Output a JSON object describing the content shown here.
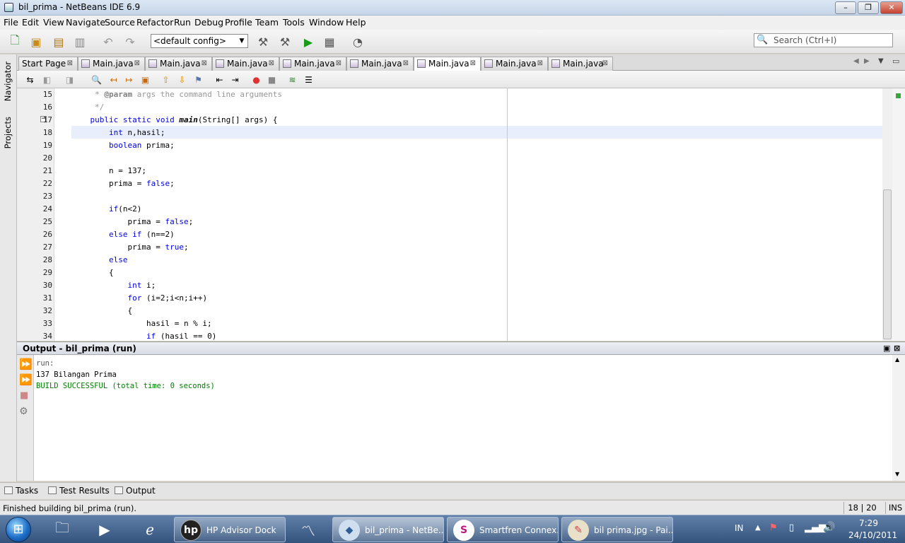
{
  "window": {
    "title": "bil_prima - NetBeans IDE 6.9"
  },
  "menu": [
    "File",
    "Edit",
    "View",
    "Navigate",
    "Source",
    "Refactor",
    "Run",
    "Debug",
    "Profile",
    "Team",
    "Tools",
    "Window",
    "Help"
  ],
  "toolbar": {
    "config": "<default config>",
    "search_placeholder": "Search (Ctrl+I)"
  },
  "side_panels": {
    "navigator": "Navigator",
    "projects": "Projects"
  },
  "tabs": [
    {
      "label": "Start Page",
      "active": false
    },
    {
      "label": "Main.java",
      "active": false
    },
    {
      "label": "Main.java",
      "active": false
    },
    {
      "label": "Main.java",
      "active": false
    },
    {
      "label": "Main.java",
      "active": false
    },
    {
      "label": "Main.java",
      "active": false
    },
    {
      "label": "Main.java",
      "active": true
    },
    {
      "label": "Main.java",
      "active": false
    },
    {
      "label": "Main.java",
      "active": false
    }
  ],
  "editor": {
    "lines": [
      {
        "no": "15",
        "text": "     * @param args the command line arguments"
      },
      {
        "no": "16",
        "text": "     */"
      },
      {
        "no": "17",
        "text": "    public static void main(String[] args) {"
      },
      {
        "no": "18",
        "text": "        int n,hasil;"
      },
      {
        "no": "19",
        "text": "        boolean prima;"
      },
      {
        "no": "20",
        "text": ""
      },
      {
        "no": "21",
        "text": "        n = 137;"
      },
      {
        "no": "22",
        "text": "        prima = false;"
      },
      {
        "no": "23",
        "text": ""
      },
      {
        "no": "24",
        "text": "        if(n<2)"
      },
      {
        "no": "25",
        "text": "            prima = false;"
      },
      {
        "no": "26",
        "text": "        else if (n==2)"
      },
      {
        "no": "27",
        "text": "            prima = true;"
      },
      {
        "no": "28",
        "text": "        else"
      },
      {
        "no": "29",
        "text": "        {"
      },
      {
        "no": "30",
        "text": "            int i;"
      },
      {
        "no": "31",
        "text": "            for (i=2;i<n;i++)"
      },
      {
        "no": "32",
        "text": "            {"
      },
      {
        "no": "33",
        "text": "                hasil = n % i;"
      },
      {
        "no": "34",
        "text": "                if (hasil == 0)"
      }
    ]
  },
  "output": {
    "title": "Output - bil_prima (run)",
    "lines": [
      "run:",
      "137 Bilangan Prima",
      "BUILD SUCCESSFUL (total time: 0 seconds)"
    ]
  },
  "bottom_tabs": [
    "Tasks",
    "Test Results",
    "Output"
  ],
  "status": {
    "message": "Finished building bil_prima (run).",
    "position": "18 | 20",
    "mode": "INS"
  },
  "taskbar": {
    "tasks": [
      {
        "label": "HP Advisor Dock"
      },
      {
        "label": "bil_prima - NetBe..."
      },
      {
        "label": "Smartfren Connex..."
      },
      {
        "label": "bil prima.jpg - Pai..."
      }
    ],
    "tray": {
      "lang": "IN",
      "time": "7:29",
      "date": "24/10/2011"
    }
  }
}
